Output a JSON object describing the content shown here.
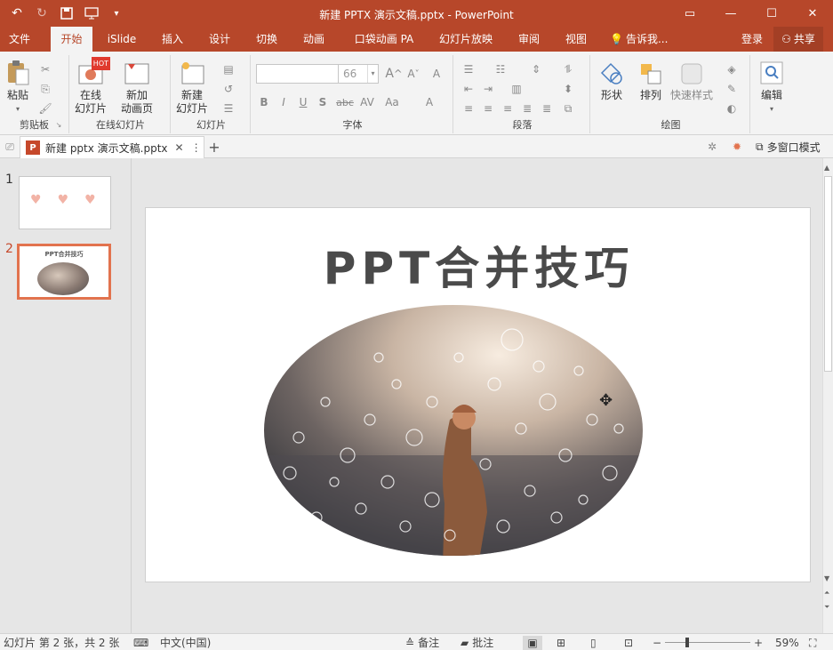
{
  "window": {
    "title": "新建 PPTX 演示文稿.pptx - PowerPoint"
  },
  "tabs": [
    "文件",
    "开始",
    "iSlide",
    "插入",
    "设计",
    "切换",
    "动画",
    "口袋动画 PA",
    "幻灯片放映",
    "审阅",
    "视图",
    "告诉我..."
  ],
  "account": {
    "login": "登录",
    "share": "共享"
  },
  "ribbon": {
    "clipboard": {
      "paste": "粘贴",
      "label": "剪贴板"
    },
    "online": {
      "btn1_l1": "在线",
      "btn1_l2": "幻灯片",
      "btn2_l1": "新加",
      "btn2_l2": "动画页",
      "hot": "HOT",
      "label": "在线幻灯片"
    },
    "slides": {
      "btn_l1": "新建",
      "btn_l2": "幻灯片",
      "label": "幻灯片"
    },
    "font": {
      "name": "",
      "size": "66",
      "label": "字体",
      "bold": "B",
      "italic": "I",
      "underline": "U",
      "shadow": "S",
      "strike": "abc"
    },
    "paragraph": {
      "label": "段落"
    },
    "drawing": {
      "shape": "形状",
      "arrange": "排列",
      "quickstyle": "快速样式",
      "label": "绘图"
    },
    "editing": {
      "edit": "编辑"
    }
  },
  "doc_tab": {
    "name": "新建 pptx 演示文稿.pptx",
    "multiwin": "多窗口模式"
  },
  "thumbs": [
    {
      "num": "1"
    },
    {
      "num": "2",
      "title": "PPT合并技巧"
    }
  ],
  "slide": {
    "title": "PPT合并技巧"
  },
  "status": {
    "slide_info": "幻灯片 第 2 张，共 2 张",
    "lang": "中文(中国)",
    "notes": "备注",
    "comments": "批注",
    "zoom": "59%"
  },
  "colors": {
    "accent": "#b7472a",
    "selection": "#e2734e"
  }
}
